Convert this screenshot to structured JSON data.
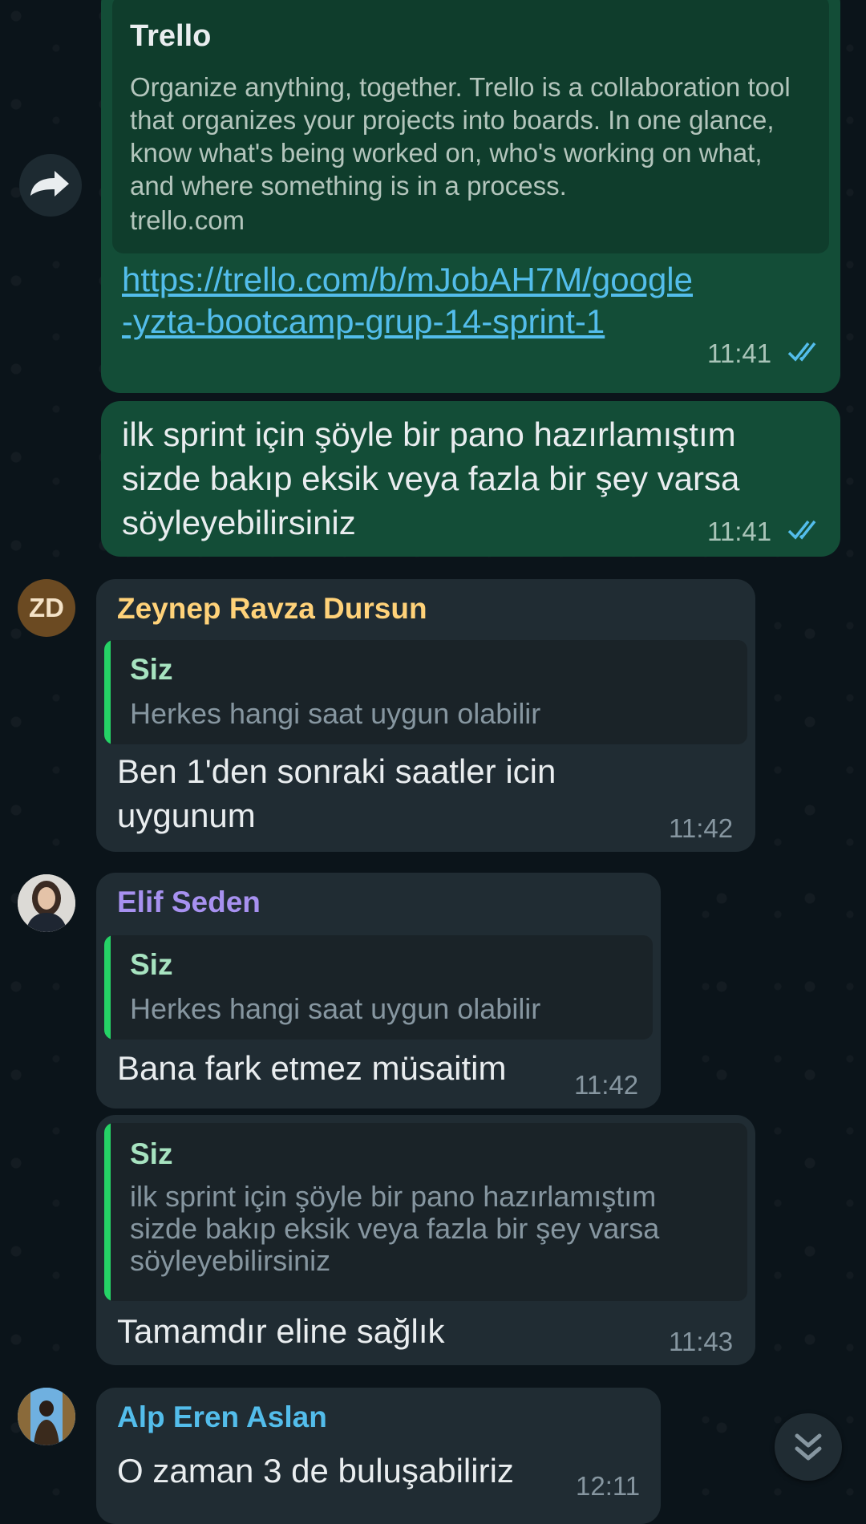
{
  "preview": {
    "title": "Trello",
    "description": "Organize anything, together. Trello is a collaboration tool that organizes your projects into boards. In one glance, know what's being worked on, who's working on what, and where something is in a process.",
    "domain": "trello.com",
    "link_line1": "https://trello.com/b/mJobAH7M/google",
    "link_line2": "-yzta-bootcamp-grup-14-sprint-1",
    "time": "11:41"
  },
  "messages": {
    "m1": {
      "line1": "ilk sprint için şöyle bir pano hazırlamıştım",
      "line2": "sizde bakıp eksik veya fazla bir şey varsa",
      "line3": "söyleyebilirsiniz",
      "time": "11:41"
    },
    "m2": {
      "avatar_initials": "ZD",
      "sender": "Zeynep Ravza Dursun",
      "quote_name": "Siz",
      "quote_text": "Herkes hangi saat uygun olabilir",
      "line1": "Ben 1'den sonraki saatler icin",
      "line2": "uygunum",
      "time": "11:42"
    },
    "m3": {
      "sender": "Elif Seden",
      "quote_name": "Siz",
      "quote_text": "Herkes hangi saat uygun olabilir",
      "line1": "Bana fark etmez müsaitim",
      "time": "11:42"
    },
    "m4": {
      "quote_name": "Siz",
      "quote_line1": "ilk sprint için şöyle bir pano hazırlamıştım",
      "quote_line2": "sizde bakıp eksik veya fazla bir şey varsa",
      "quote_line3": "söyleyebilirsiniz",
      "line1": "Tamamdır eline sağlık",
      "time": "11:43"
    },
    "m5": {
      "sender": "Alp Eren Aslan",
      "line1": "O zaman 3 de buluşabiliriz",
      "time": "12:11"
    }
  },
  "colors": {
    "background": "#0b141a",
    "outgoing_bubble": "#134d37",
    "incoming_bubble": "#202c33",
    "link": "#53bdeb",
    "read_ticks": "#53bdeb",
    "sender_zeynep": "#ffd279",
    "sender_elif": "#a791f0",
    "sender_alp": "#53bdeb",
    "quote_bar": "#25d366"
  },
  "icons": {
    "forward": "forward-arrow-icon",
    "ticks": "double-check-icon",
    "scroll_down": "double-chevron-down-icon"
  }
}
